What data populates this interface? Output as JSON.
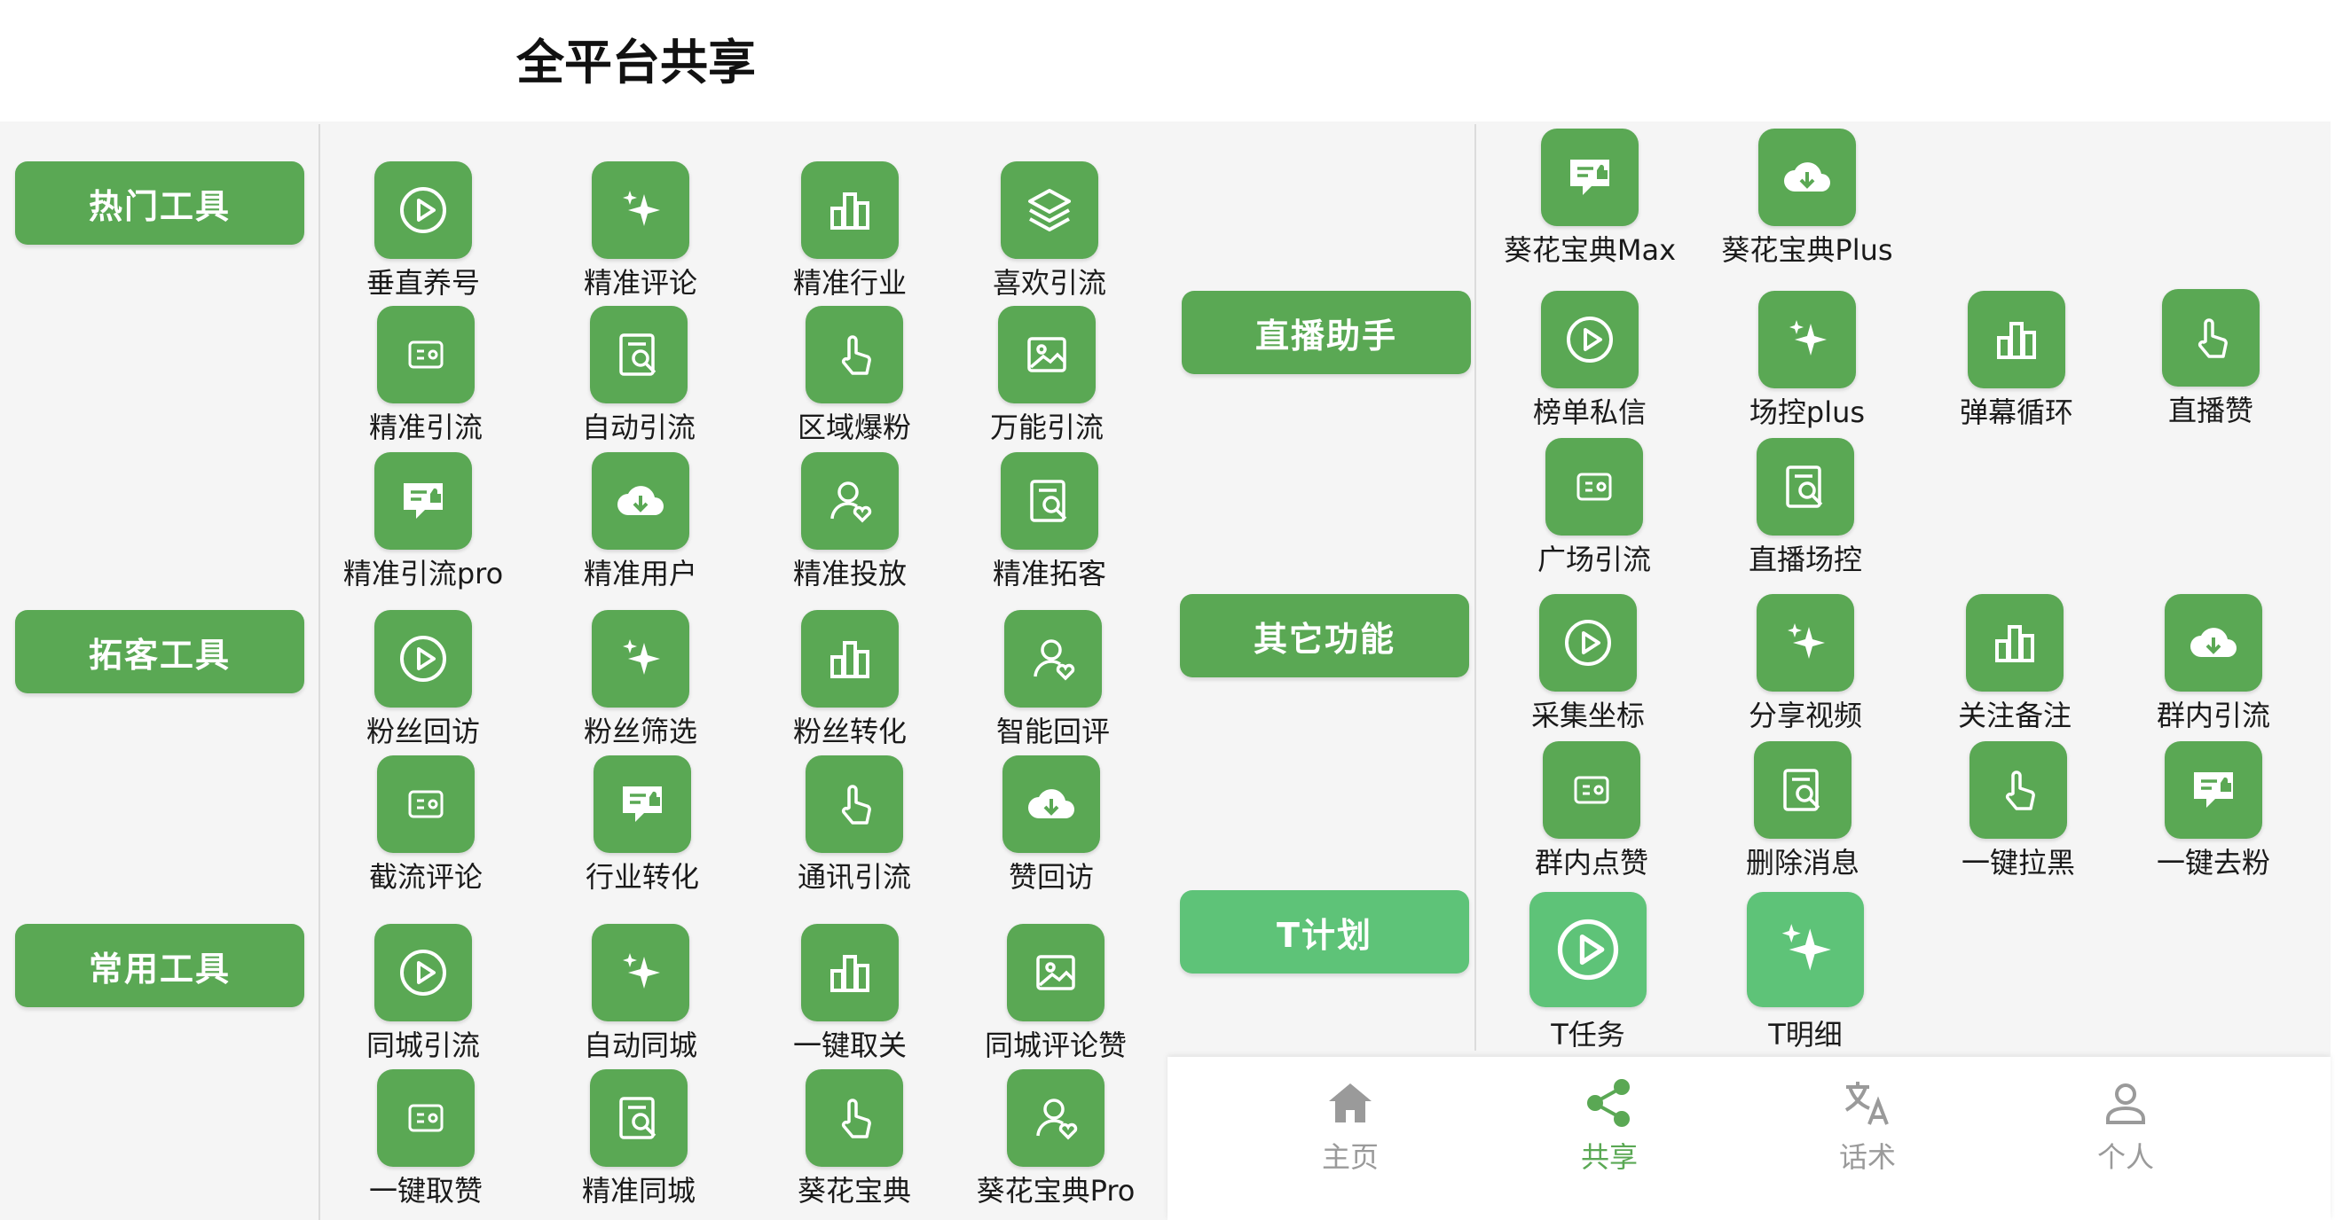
{
  "page_title": "全平台共享",
  "categories": [
    {
      "label": "热门工具"
    },
    {
      "label": "拓客工具"
    },
    {
      "label": "常用工具"
    },
    {
      "label": "直播助手"
    },
    {
      "label": "其它功能"
    },
    {
      "label": "T计划"
    }
  ],
  "tools": [
    {
      "label": "垂直养号",
      "icon": "play-icon"
    },
    {
      "label": "精准评论",
      "icon": "sparkle-icon"
    },
    {
      "label": "精准行业",
      "icon": "bar-chart-icon"
    },
    {
      "label": "喜欢引流",
      "icon": "layers-icon"
    },
    {
      "label": "精准引流",
      "icon": "card-icon"
    },
    {
      "label": "自动引流",
      "icon": "doc-search-icon"
    },
    {
      "label": "区域爆粉",
      "icon": "tap-icon"
    },
    {
      "label": "万能引流",
      "icon": "image-icon"
    },
    {
      "label": "精准引流pro",
      "icon": "like-message-icon"
    },
    {
      "label": "精准用户",
      "icon": "cloud-download-icon"
    },
    {
      "label": "精准投放",
      "icon": "user-heart-icon"
    },
    {
      "label": "精准拓客",
      "icon": "doc-search-icon"
    },
    {
      "label": "粉丝回访",
      "icon": "play-icon"
    },
    {
      "label": "粉丝筛选",
      "icon": "sparkle-icon"
    },
    {
      "label": "粉丝转化",
      "icon": "bar-chart-icon"
    },
    {
      "label": "智能回评",
      "icon": "user-heart-icon"
    },
    {
      "label": "截流评论",
      "icon": "card-icon"
    },
    {
      "label": "行业转化",
      "icon": "like-message-icon"
    },
    {
      "label": "通讯引流",
      "icon": "tap-icon"
    },
    {
      "label": "赞回访",
      "icon": "cloud-download-icon"
    },
    {
      "label": "同城引流",
      "icon": "play-icon"
    },
    {
      "label": "自动同城",
      "icon": "sparkle-icon"
    },
    {
      "label": "一键取关",
      "icon": "bar-chart-icon"
    },
    {
      "label": "同城评论赞",
      "icon": "image-icon"
    },
    {
      "label": "一键取赞",
      "icon": "card-icon"
    },
    {
      "label": "精准同城",
      "icon": "doc-search-icon"
    },
    {
      "label": "葵花宝典",
      "icon": "tap-icon"
    },
    {
      "label": "葵花宝典Pro",
      "icon": "user-heart-icon"
    },
    {
      "label": "葵花宝典Max",
      "icon": "like-message-icon"
    },
    {
      "label": "葵花宝典Plus",
      "icon": "cloud-download-icon"
    },
    {
      "label": "榜单私信",
      "icon": "play-icon"
    },
    {
      "label": "场控plus",
      "icon": "sparkle-icon"
    },
    {
      "label": "弹幕循环",
      "icon": "bar-chart-icon"
    },
    {
      "label": "直播赞",
      "icon": "tap-icon"
    },
    {
      "label": "广场引流",
      "icon": "card-icon"
    },
    {
      "label": "直播场控",
      "icon": "doc-search-icon"
    },
    {
      "label": "采集坐标",
      "icon": "play-icon"
    },
    {
      "label": "分享视频",
      "icon": "sparkle-icon"
    },
    {
      "label": "关注备注",
      "icon": "bar-chart-icon"
    },
    {
      "label": "群内引流",
      "icon": "cloud-download-icon"
    },
    {
      "label": "群内点赞",
      "icon": "card-icon"
    },
    {
      "label": "删除消息",
      "icon": "doc-search-icon"
    },
    {
      "label": "一键拉黑",
      "icon": "tap-icon"
    },
    {
      "label": "一键去粉",
      "icon": "like-message-icon"
    },
    {
      "label": "T任务",
      "icon": "play-icon"
    },
    {
      "label": "T明细",
      "icon": "sparkle-icon"
    }
  ],
  "nav": [
    {
      "label": "主页",
      "icon": "home-icon"
    },
    {
      "label": "共享",
      "icon": "share-icon"
    },
    {
      "label": "话术",
      "icon": "translate-icon"
    },
    {
      "label": "个人",
      "icon": "person-icon"
    }
  ],
  "colors": {
    "accent": "#5aa854",
    "accent_light": "#5ec378",
    "panel": "#f5f5f5",
    "nav_inactive": "#9a9a9a"
  }
}
